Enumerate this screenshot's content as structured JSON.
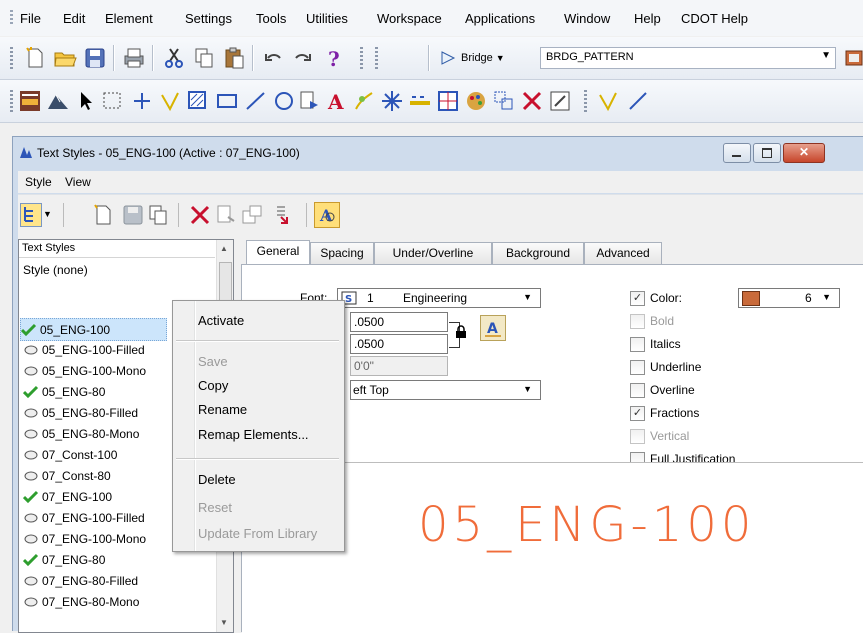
{
  "menubar": {
    "items": [
      "File",
      "Edit",
      "Element",
      "Settings",
      "Tools",
      "Utilities",
      "Workspace",
      "Applications",
      "Window",
      "Help",
      "CDOT Help"
    ]
  },
  "toolbar": {
    "bridge_label": "Bridge",
    "level_combo": "BRDG_PATTERN"
  },
  "dialog": {
    "title": "Text Styles - 05_ENG-100 (Active : 07_ENG-100)",
    "menu": [
      "Style",
      "View"
    ],
    "list": {
      "header": "Text Styles",
      "items": [
        {
          "label": "Style (none)",
          "icon": "none"
        },
        {
          "label": "05_ENG-100",
          "icon": "check-icon"
        },
        {
          "label": "05_ENG-100-Filled",
          "icon": "style-icon"
        },
        {
          "label": "05_ENG-100-Mono",
          "icon": "style-icon"
        },
        {
          "label": "05_ENG-80",
          "icon": "check-icon"
        },
        {
          "label": "05_ENG-80-Filled",
          "icon": "style-icon"
        },
        {
          "label": "05_ENG-80-Mono",
          "icon": "style-icon"
        },
        {
          "label": "07_Const-100",
          "icon": "style-icon"
        },
        {
          "label": "07_Const-80",
          "icon": "style-icon"
        },
        {
          "label": "07_ENG-100",
          "icon": "check-icon"
        },
        {
          "label": "07_ENG-100-Filled",
          "icon": "style-icon"
        },
        {
          "label": "07_ENG-100-Mono",
          "icon": "style-icon"
        },
        {
          "label": "07_ENG-80",
          "icon": "check-icon"
        },
        {
          "label": "07_ENG-80-Filled",
          "icon": "style-icon"
        },
        {
          "label": "07_ENG-80-Mono",
          "icon": "style-icon"
        }
      ]
    },
    "tabs": [
      "General",
      "Spacing",
      "Under/Overline",
      "Background",
      "Advanced"
    ],
    "general": {
      "font_label": "Font:",
      "font_number": "1",
      "font_name": "Engineering",
      "width_value": ".0500",
      "height_value": ".0500",
      "slant_value": "0'0\"",
      "justification": "eft Top",
      "color_label": "Color:",
      "color_value": "6",
      "checkboxes": [
        {
          "label": "Color:",
          "checked": true,
          "disabled": false
        },
        {
          "label": "Bold",
          "checked": false,
          "disabled": true
        },
        {
          "label": "Italics",
          "checked": false,
          "disabled": false
        },
        {
          "label": "Underline",
          "checked": false,
          "disabled": false
        },
        {
          "label": "Overline",
          "checked": false,
          "disabled": false
        },
        {
          "label": "Fractions",
          "checked": true,
          "disabled": false
        },
        {
          "label": "Vertical",
          "checked": false,
          "disabled": true
        },
        {
          "label": "Full Justification",
          "checked": false,
          "disabled": false
        }
      ]
    },
    "preview_text": "05_ENG-100"
  },
  "context_menu": {
    "items": [
      {
        "label": "Activate",
        "disabled": false
      },
      {
        "label": "Save",
        "disabled": true
      },
      {
        "label": "Copy",
        "disabled": false
      },
      {
        "label": "Rename",
        "disabled": false
      },
      {
        "label": "Remap Elements...",
        "disabled": false
      },
      {
        "label": "Delete",
        "disabled": false
      },
      {
        "label": "Reset",
        "disabled": true
      },
      {
        "label": "Update From Library",
        "disabled": true
      }
    ]
  },
  "colors": {
    "dialog_frame": "#cfdcec",
    "preview_text": "#f06c3a",
    "check_green": "#2e9e2e"
  }
}
